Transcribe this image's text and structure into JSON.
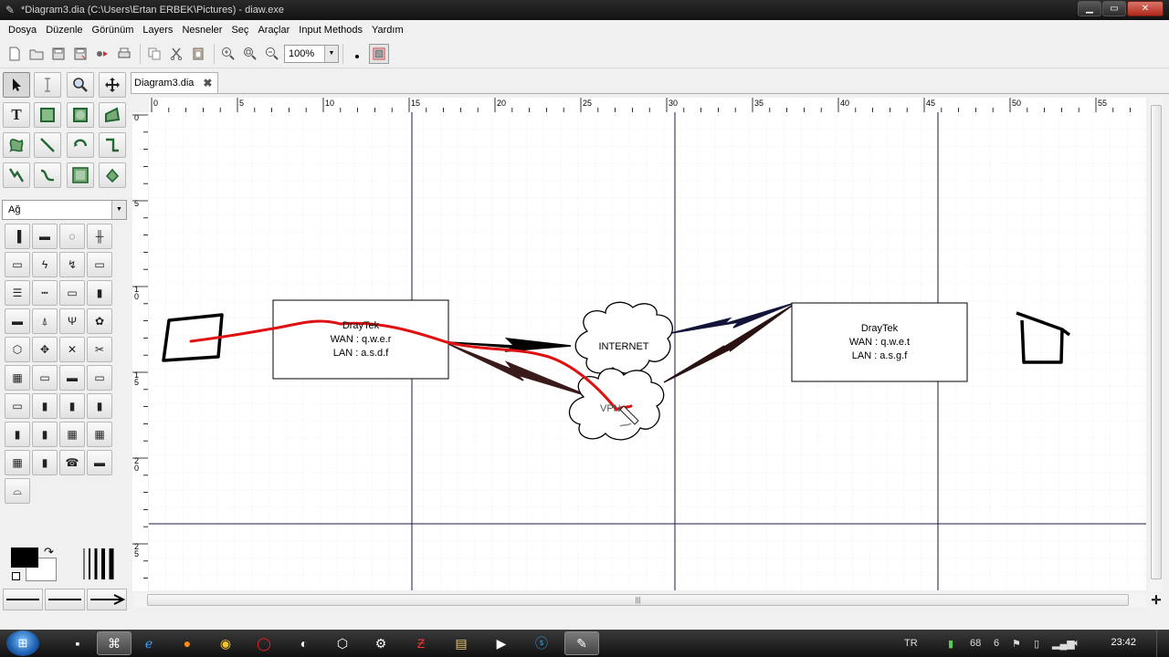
{
  "window": {
    "title": "*Diagram3.dia (C:\\Users\\Ertan ERBEK\\Pictures) - diaw.exe",
    "minimize": "▁",
    "maximize": "▭",
    "close": "✕"
  },
  "menu": [
    "Dosya",
    "Düzenle",
    "Görünüm",
    "Layers",
    "Nesneler",
    "Seç",
    "Araçlar",
    "Input Methods",
    "Yardım"
  ],
  "toolbar": {
    "zoom_value": "100%"
  },
  "toolbox": {
    "sheet": "Ağ",
    "tools": [
      "pointer",
      "text-cursor",
      "magnify",
      "move-scroll",
      "text",
      "box",
      "ellipse",
      "polygon",
      "beziergon",
      "line",
      "arc",
      "zigzag",
      "polyline",
      "bezier",
      "image",
      "outline"
    ]
  },
  "tab": {
    "label": "Diagram3.dia"
  },
  "ruler": {
    "h_labels": [
      "0",
      "5",
      "10",
      "15",
      "20",
      "25",
      "30",
      "35",
      "40",
      "45",
      "50",
      "55"
    ],
    "v_labels": [
      "0",
      "5",
      "10",
      "15",
      "20",
      "25"
    ]
  },
  "diagram": {
    "box_left": {
      "title": "DrayTek",
      "wan": "WAN : q.w.e.r",
      "lan": "LAN : a.s.d.f"
    },
    "box_right": {
      "title": "DrayTek",
      "wan": "WAN : q.w.e.t",
      "lan": "LAN : a.s.g.f"
    },
    "cloud_internet": "INTERNET",
    "cloud_vpn": "VPN"
  },
  "taskbar": {
    "lang": "TR",
    "battery": "68",
    "count": "6",
    "time": "23:42"
  },
  "colors": {
    "titlebar": "#1a1a1a",
    "red_stroke": "#e01010",
    "guide": "#1a1a4a"
  }
}
